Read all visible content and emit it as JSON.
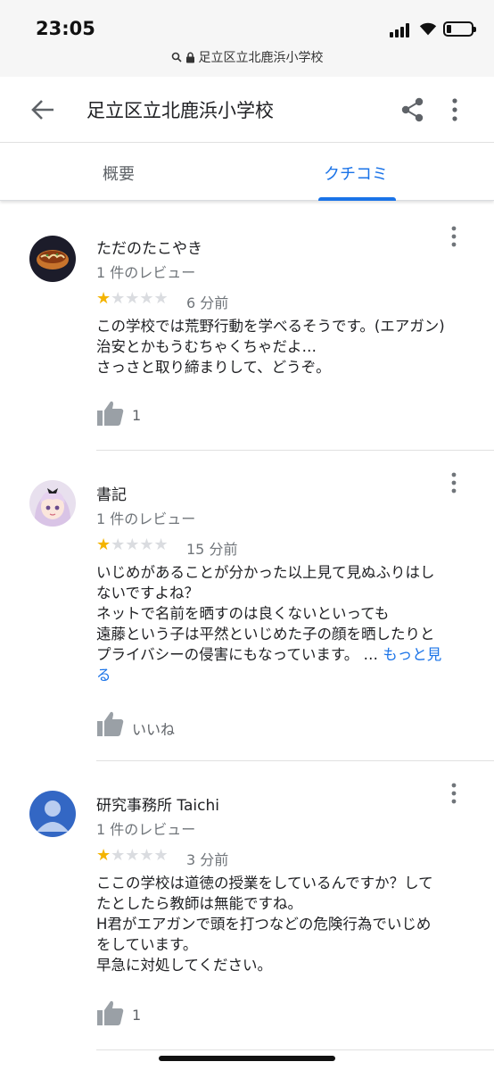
{
  "status_bar": {
    "time": "23:05",
    "battery_icon": "battery-low-icon",
    "wifi_icon": "wifi-icon",
    "signal_icon": "cellular-signal-icon"
  },
  "url_bar": {
    "url": "足立区立北鹿浜小学校",
    "search_icon": "search-icon",
    "lock_icon": "lock-icon"
  },
  "app_bar": {
    "title": "足立区立北鹿浜小学校",
    "back_icon": "arrow-left-icon",
    "share_icon": "share-icon",
    "more_icon": "more-vert-icon"
  },
  "tabs": [
    {
      "label": "概要",
      "active": false
    },
    {
      "label": "クチコミ",
      "active": true
    }
  ],
  "colors": {
    "accent": "#1a73e8",
    "star": "#f4b400",
    "star_empty": "#dadce0",
    "meta_text": "#70757a"
  },
  "reviews": [
    {
      "name": "ただのたこやき",
      "review_count": "1 件のレビュー",
      "rating": 1,
      "time": "6 分前",
      "text_lines": [
        "この学校では荒野行動を学べるそうです。(エアガン)",
        "治安とかもうむちゃくちゃだよ…",
        "さっさと取り締まりして、どうぞ。"
      ],
      "more_link": "",
      "like_label": "1",
      "avatar_icon": "takoyaki-avatar"
    },
    {
      "name": "書記",
      "review_count": "1 件のレビュー",
      "rating": 1,
      "time": "15 分前",
      "text_lines": [
        "いじめがあることが分かった以上見て見ぬふりはし",
        "ないですよね？",
        "ネットで名前を晒すのは良くないといっても",
        "遠藤という子は平然といじめた子の顔を晒したりと",
        "プライバシーの侵害にもなっています。 …"
      ],
      "more_link_part1": "もっと見",
      "more_link_part2": "る",
      "like_label": "いいね",
      "avatar_icon": "anime-girl-avatar"
    },
    {
      "name": "研究事務所 Taichi",
      "review_count": "1 件のレビュー",
      "rating": 1,
      "time": "3 分前",
      "text_lines": [
        "ここの学校は道徳の授業をしているんですか？して",
        "たとしたら教師は無能ですね。",
        " H君がエアガンで頭を打つなどの危険行為でいじめ",
        "をしています。",
        "早急に対処してください。"
      ],
      "more_link": "",
      "like_label": "1",
      "avatar_icon": "default-person-avatar"
    }
  ]
}
